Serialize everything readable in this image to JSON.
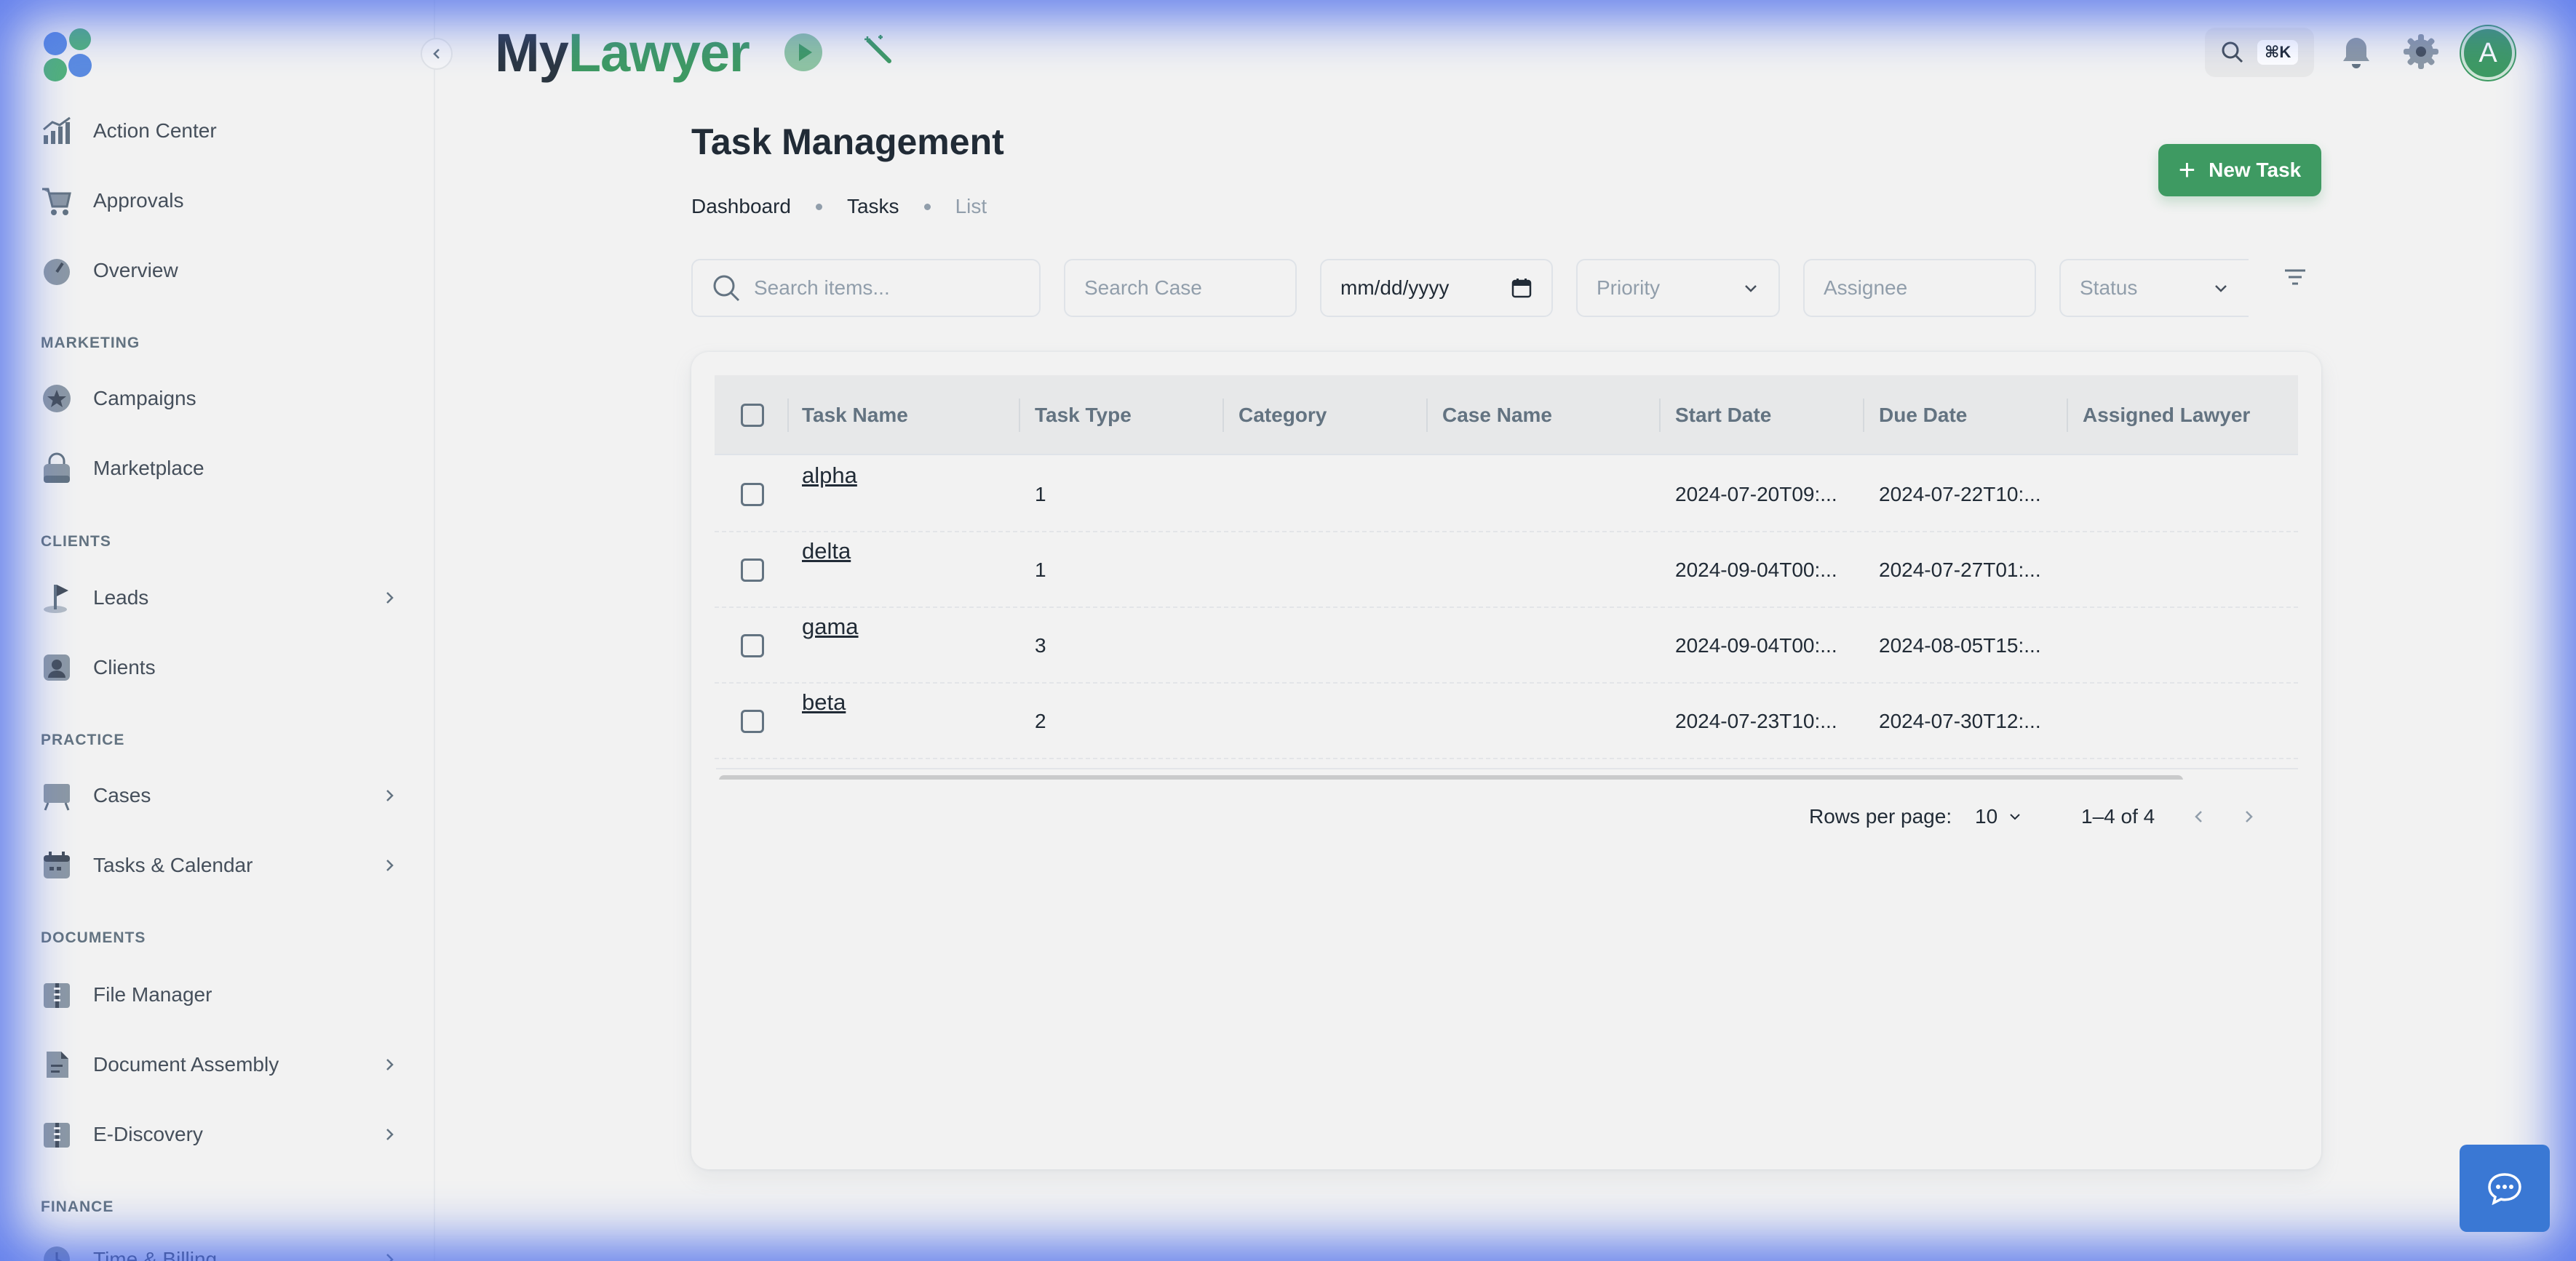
{
  "app": {
    "brand_my": "My",
    "brand_lawyer": "Lawyer",
    "search_shortcut": "⌘K",
    "avatar_initial": "A",
    "brand_color": "#3e9a62"
  },
  "sidebar": {
    "items": [
      {
        "label": "Action Center",
        "icon": "chart-up-icon"
      },
      {
        "label": "Approvals",
        "icon": "cart-icon"
      },
      {
        "label": "Overview",
        "icon": "gauge-icon"
      }
    ],
    "sections": {
      "marketing": {
        "heading": "MARKETING",
        "items": [
          {
            "label": "Campaigns",
            "icon": "star-badge-icon"
          },
          {
            "label": "Marketplace",
            "icon": "bag-icon"
          }
        ]
      },
      "clients": {
        "heading": "CLIENTS",
        "items": [
          {
            "label": "Leads",
            "icon": "flag-icon"
          },
          {
            "label": "Clients",
            "icon": "user-card-icon"
          }
        ]
      },
      "practice": {
        "heading": "PRACTICE",
        "items": [
          {
            "label": "Cases",
            "icon": "board-icon"
          },
          {
            "label": "Tasks & Calendar",
            "icon": "calendar-icon"
          }
        ]
      },
      "documents": {
        "heading": "DOCUMENTS",
        "items": [
          {
            "label": "File Manager",
            "icon": "folder-icon"
          },
          {
            "label": "Document Assembly",
            "icon": "file-icon"
          },
          {
            "label": "E-Discovery",
            "icon": "folder-zip-icon"
          }
        ]
      },
      "finance": {
        "heading": "FINANCE",
        "items": [
          {
            "label": "Time & Billing",
            "icon": "clock-icon"
          }
        ]
      }
    }
  },
  "page": {
    "title": "Task Management",
    "breadcrumb": [
      "Dashboard",
      "Tasks",
      "List"
    ],
    "new_task_label": "New Task"
  },
  "filters": {
    "search_placeholder": "Search items...",
    "case_placeholder": "Search Case",
    "date_value": "mm/dd/yyyy",
    "priority_placeholder": "Priority",
    "assignee_placeholder": "Assignee",
    "status_placeholder": "Status"
  },
  "table": {
    "columns": [
      "Task Name",
      "Task Type",
      "Category",
      "Case Name",
      "Start Date",
      "Due Date",
      "Assigned Lawyer"
    ],
    "rows": [
      {
        "name": "alpha",
        "type": "1",
        "category": "",
        "case": "",
        "start": "2024-07-20T09:...",
        "due": "2024-07-22T10:...",
        "lawyer": ""
      },
      {
        "name": "delta",
        "type": "1",
        "category": "",
        "case": "",
        "start": "2024-09-04T00:...",
        "due": "2024-07-27T01:...",
        "lawyer": ""
      },
      {
        "name": "gama",
        "type": "3",
        "category": "",
        "case": "",
        "start": "2024-09-04T00:...",
        "due": "2024-08-05T15:...",
        "lawyer": ""
      },
      {
        "name": "beta",
        "type": "2",
        "category": "",
        "case": "",
        "start": "2024-07-23T10:...",
        "due": "2024-07-30T12:...",
        "lawyer": ""
      }
    ]
  },
  "pagination": {
    "rows_per_page_label": "Rows per page:",
    "rows_per_page": "10",
    "range": "1–4 of 4"
  }
}
